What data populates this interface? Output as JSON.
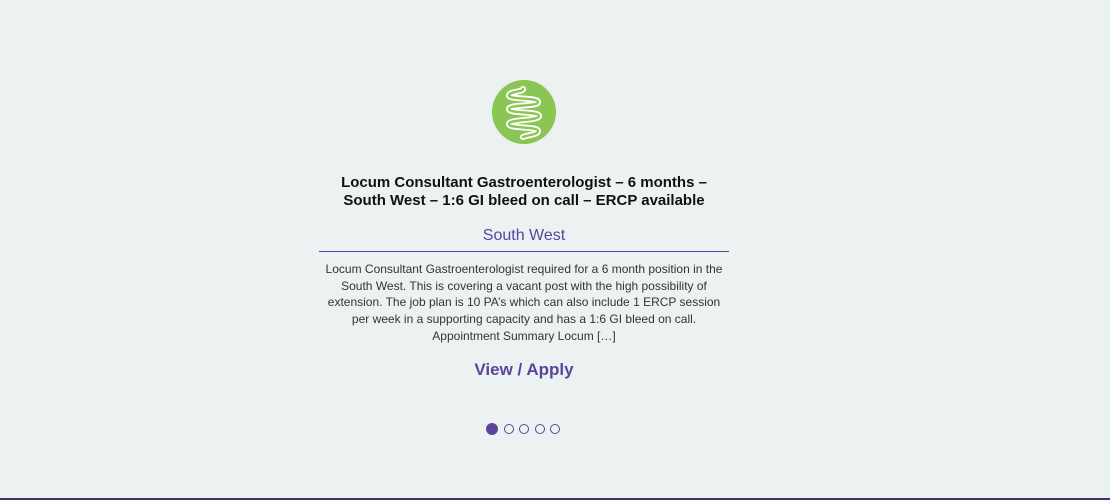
{
  "slide": {
    "logo_icon": "intestine-icon",
    "logo_color": "#8bc553",
    "title_line1": "Locum Consultant Gastroenterologist – 6 months –",
    "title_line2": "South West – 1:6 GI bleed on call – ERCP available",
    "location": "South West",
    "description": "Locum Consultant Gastroenterologist required for a 6 month position in the South West. This is covering a vacant post with the high possibility of extension. The job plan is 10 PA’s which can also include 1 ERCP session per week in a supporting capacity and has a 1:6 GI bleed on call. Appointment Summary Locum […]",
    "cta_label": "View / Apply"
  },
  "carousel": {
    "slide_count": 5,
    "active_index": 0
  },
  "colors": {
    "background": "#ecf2f2",
    "accent": "#5a449c",
    "logo": "#8bc553"
  }
}
